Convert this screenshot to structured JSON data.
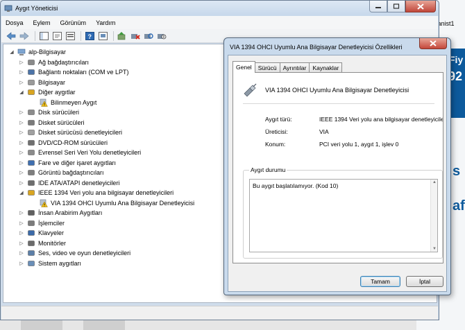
{
  "background": {
    "app_title": "Piyanist1",
    "big_text_1": "Fiy",
    "big_text_2": "92",
    "big_text_3": "s",
    "big_text_4": "af"
  },
  "window": {
    "title": "Aygıt Yöneticisi",
    "menu": [
      "Dosya",
      "Eylem",
      "Görünüm",
      "Yardım"
    ]
  },
  "tree": {
    "root": "alp-Bilgisayar",
    "items": [
      {
        "label": "Ağ bağdaştırıcıları",
        "level": 1,
        "expanded": false,
        "icon": "network-adapter-icon"
      },
      {
        "label": "Bağlantı noktaları (COM ve LPT)",
        "level": 1,
        "expanded": false,
        "icon": "port-icon"
      },
      {
        "label": "Bilgisayar",
        "level": 1,
        "expanded": false,
        "icon": "computer-icon"
      },
      {
        "label": "Diğer aygıtlar",
        "level": 1,
        "expanded": true,
        "icon": "other-devices-icon"
      },
      {
        "label": "Bilinmeyen Aygıt",
        "level": 2,
        "expanded": null,
        "icon": "warning-device-icon"
      },
      {
        "label": "Disk sürücüleri",
        "level": 1,
        "expanded": false,
        "icon": "disk-drive-icon"
      },
      {
        "label": "Disket sürücüleri",
        "level": 1,
        "expanded": false,
        "icon": "floppy-drive-icon"
      },
      {
        "label": "Disket sürücüsü denetleyicileri",
        "level": 1,
        "expanded": false,
        "icon": "floppy-controller-icon"
      },
      {
        "label": "DVD/CD-ROM sürücüleri",
        "level": 1,
        "expanded": false,
        "icon": "dvd-icon"
      },
      {
        "label": "Evrensel Seri Veri Yolu denetleyicileri",
        "level": 1,
        "expanded": false,
        "icon": "usb-icon"
      },
      {
        "label": "Fare ve diğer işaret aygıtları",
        "level": 1,
        "expanded": false,
        "icon": "mouse-icon"
      },
      {
        "label": "Görüntü bağdaştırıcıları",
        "level": 1,
        "expanded": false,
        "icon": "display-adapter-icon"
      },
      {
        "label": "IDE ATA/ATAPI denetleyicileri",
        "level": 1,
        "expanded": false,
        "icon": "ide-icon"
      },
      {
        "label": "IEEE 1394 Veri yolu ana bilgisayar denetleyicileri",
        "level": 1,
        "expanded": true,
        "icon": "firewire-icon"
      },
      {
        "label": "VIA 1394 OHCI Uyumlu Ana Bilgisayar Denetleyicisi",
        "level": 2,
        "expanded": null,
        "icon": "warning-device-icon"
      },
      {
        "label": "İnsan Arabirim Aygıtları",
        "level": 1,
        "expanded": false,
        "icon": "hid-icon"
      },
      {
        "label": "İşlemciler",
        "level": 1,
        "expanded": false,
        "icon": "processor-icon"
      },
      {
        "label": "Klavyeler",
        "level": 1,
        "expanded": false,
        "icon": "keyboard-icon"
      },
      {
        "label": "Monitörler",
        "level": 1,
        "expanded": false,
        "icon": "monitor-icon"
      },
      {
        "label": "Ses, video ve oyun denetleyicileri",
        "level": 1,
        "expanded": false,
        "icon": "sound-icon"
      },
      {
        "label": "Sistem aygıtları",
        "level": 1,
        "expanded": false,
        "icon": "system-devices-icon"
      }
    ]
  },
  "dialog": {
    "title": "VIA 1394 OHCI Uyumlu Ana Bilgisayar Denetleyicisi Özellikleri",
    "tabs": [
      "Genel",
      "Sürücü",
      "Ayrıntılar",
      "Kaynaklar"
    ],
    "active_tab": "Genel",
    "device_name": "VIA 1394 OHCI Uyumlu Ana Bilgisayar Denetleyicisi",
    "props": [
      {
        "label": "Aygıt türü:",
        "value": "IEEE 1394 Veri yolu ana bilgisayar denetleyicile"
      },
      {
        "label": "Üreticisi:",
        "value": "VIA"
      },
      {
        "label": "Konum:",
        "value": "PCI veri yolu 1, aygıt 1, işlev 0"
      }
    ],
    "status_group": "Aygıt durumu",
    "status_text": "Bu aygıt başlatılamıyor. (Kod 10)",
    "ok_label": "Tamam",
    "cancel_label": "İptal"
  },
  "colors": {
    "accent_blue": "#0d5a9c",
    "close_red": "#c4473a",
    "titlebar": "#c9daec"
  }
}
